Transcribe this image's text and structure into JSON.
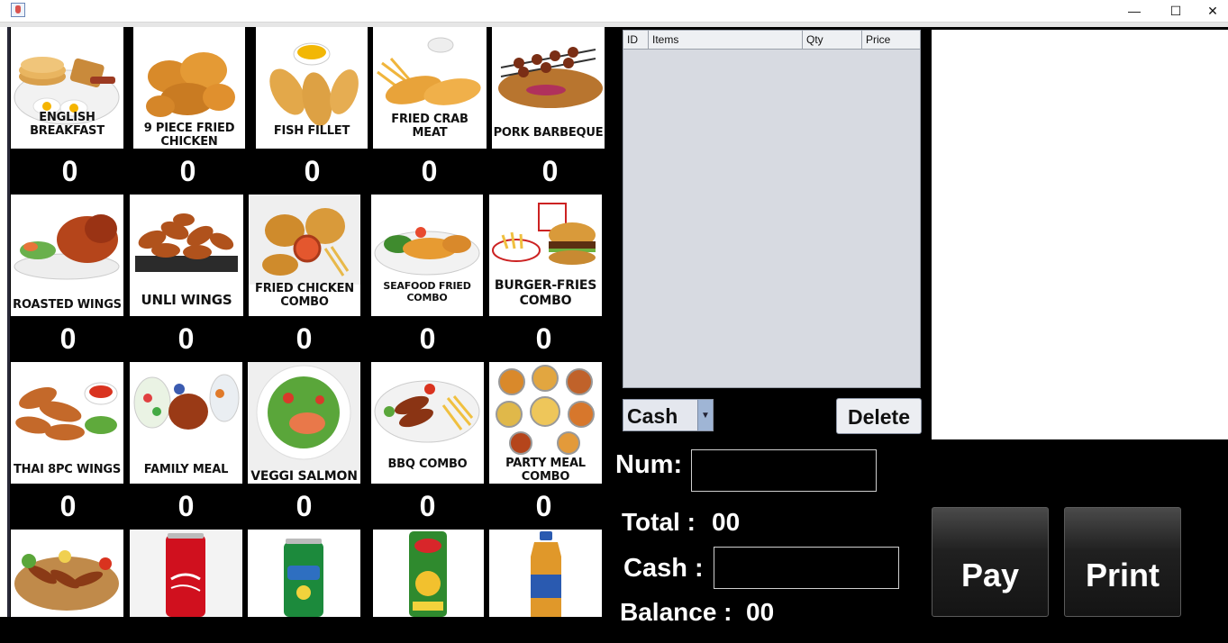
{
  "window": {
    "minimize": "—",
    "maximize": "☐",
    "close": "✕"
  },
  "menu": [
    {
      "label": "ENGLISH BREAKFAST",
      "qty": "0",
      "icon": "english-breakfast-image"
    },
    {
      "label": "9 PIECE FRIED CHICKEN",
      "qty": "0",
      "icon": "fried-chicken-image"
    },
    {
      "label": "FISH FILLET",
      "qty": "0",
      "icon": "fish-fillet-image"
    },
    {
      "label": "FRIED CRAB MEAT",
      "qty": "0",
      "icon": "crab-meat-image"
    },
    {
      "label": "PORK BARBEQUE",
      "qty": "0",
      "icon": "pork-barbeque-image"
    },
    {
      "label": "ROASTED WINGS",
      "qty": "0",
      "icon": "roasted-wings-image"
    },
    {
      "label": "UNLI WINGS",
      "qty": "0",
      "icon": "unli-wings-image"
    },
    {
      "label": "FRIED CHICKEN COMBO",
      "qty": "0",
      "icon": "chicken-combo-image"
    },
    {
      "label": "SEAFOOD FRIED COMBO",
      "qty": "0",
      "icon": "seafood-combo-image"
    },
    {
      "label": "BURGER-FRIES COMBO",
      "qty": "0",
      "icon": "burger-fries-image"
    },
    {
      "label": "THAI 8PC WINGS",
      "qty": "0",
      "icon": "thai-wings-image"
    },
    {
      "label": "FAMILY MEAL",
      "qty": "0",
      "icon": "family-meal-image"
    },
    {
      "label": "VEGGI SALMON",
      "qty": "0",
      "icon": "veggi-salmon-image"
    },
    {
      "label": "BBQ COMBO",
      "qty": "0",
      "icon": "bbq-combo-image"
    },
    {
      "label": "PARTY MEAL COMBO",
      "qty": "0",
      "icon": "party-meal-image"
    },
    {
      "label": "",
      "qty": "",
      "icon": "skewer-platter-image"
    },
    {
      "label": "",
      "qty": "",
      "icon": "coca-cola-can-image"
    },
    {
      "label": "",
      "qty": "",
      "icon": "sprite-can-image"
    },
    {
      "label": "",
      "qty": "",
      "icon": "del-monte-juice-image"
    },
    {
      "label": "",
      "qty": "",
      "icon": "nestea-bottle-image"
    }
  ],
  "table": {
    "columns": [
      "ID",
      "Items",
      "Qty",
      "Price"
    ]
  },
  "payment": {
    "method": "Cash",
    "delete_label": "Delete",
    "num_label": "Num:",
    "num_value": "",
    "total_label": "Total :",
    "total_value": "00",
    "cash_label": "Cash :",
    "cash_value": "",
    "balance_label": "Balance :",
    "balance_value": "00",
    "pay_label": "Pay",
    "print_label": "Print"
  },
  "colors": {
    "background": "#000000",
    "table_bg": "#d7dae1",
    "tile_bg": "#ffffff"
  }
}
